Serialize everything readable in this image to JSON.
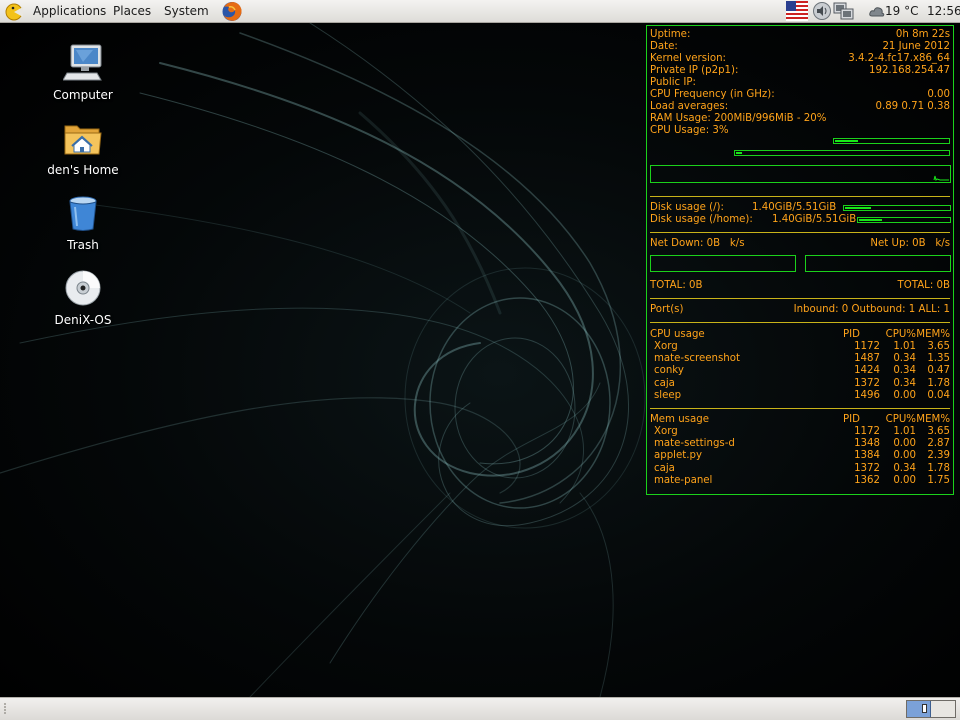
{
  "top_panel": {
    "menus": [
      "Applications",
      "Places",
      "System"
    ],
    "weather": "19 °C",
    "clock": "12:56"
  },
  "desktop_icons": [
    {
      "label": "Computer",
      "icon": "computer-icon"
    },
    {
      "label": "den's Home",
      "icon": "home-folder-icon"
    },
    {
      "label": "Trash",
      "icon": "trash-icon"
    },
    {
      "label": "DeniX-OS",
      "icon": "disc-icon"
    }
  ],
  "conky": {
    "uptime_label": "Uptime:",
    "uptime": "0h 8m 22s",
    "date_label": "Date:",
    "date": "21 June 2012",
    "kernel_label": "Kernel version:",
    "kernel": "3.4.2-4.fc17.x86_64",
    "private_ip_label": "Private IP (p2p1):",
    "private_ip": "192.168.254.47",
    "public_ip_label": "Public IP:",
    "cpu_freq_label": "CPU Frequency (in GHz):",
    "cpu_freq": "0.00",
    "load_label": "Load averages:",
    "load": "0.89 0.71 0.38",
    "ram_label": "RAM Usage:",
    "ram": "200MiB/996MiB - 20%",
    "ram_fraction": 0.2,
    "cpu_label": "CPU Usage:",
    "cpu": "3%",
    "cpu_fraction": 0.03,
    "disk_root_label": "Disk usage (/):",
    "disk_root": "1.40GiB/5.51GiB",
    "disk_root_fraction": 0.25,
    "disk_home_label": "Disk usage (/home):",
    "disk_home": "1.40GiB/5.51GiB",
    "disk_home_fraction": 0.25,
    "net_down_label": "Net Down:",
    "net_down": "0B",
    "net_down_unit": "k/s",
    "net_up_label": "Net Up:",
    "net_up": "0B",
    "net_up_unit": "k/s",
    "total_down_label": "TOTAL:",
    "total_down": "0B",
    "total_up_label": "TOTAL:",
    "total_up": "0B",
    "ports_label": "Port(s)",
    "inbound_label": "Inbound:",
    "inbound": "0",
    "outbound_label": "Outbound:",
    "outbound": "1",
    "all_label": "ALL:",
    "all": "1",
    "cpu_usage_title": "CPU usage",
    "mem_usage_title": "Mem usage",
    "col_pid": "PID",
    "col_cpu": "CPU%",
    "col_mem": "MEM%",
    "cpu_procs": [
      {
        "name": "Xorg",
        "pid": "1172",
        "cpu": "1.01",
        "mem": "3.65"
      },
      {
        "name": "mate-screenshot",
        "pid": "1487",
        "cpu": "0.34",
        "mem": "1.35"
      },
      {
        "name": "conky",
        "pid": "1424",
        "cpu": "0.34",
        "mem": "0.47"
      },
      {
        "name": "caja",
        "pid": "1372",
        "cpu": "0.34",
        "mem": "1.78"
      },
      {
        "name": "sleep",
        "pid": "1496",
        "cpu": "0.00",
        "mem": "0.04"
      }
    ],
    "mem_procs": [
      {
        "name": "Xorg",
        "pid": "1172",
        "cpu": "1.01",
        "mem": "3.65"
      },
      {
        "name": "mate-settings-d",
        "pid": "1348",
        "cpu": "0.00",
        "mem": "2.87"
      },
      {
        "name": "applet.py",
        "pid": "1384",
        "cpu": "0.00",
        "mem": "2.39"
      },
      {
        "name": "caja",
        "pid": "1372",
        "cpu": "0.34",
        "mem": "1.78"
      },
      {
        "name": "mate-panel",
        "pid": "1362",
        "cpu": "0.00",
        "mem": "1.75"
      }
    ]
  },
  "colors": {
    "conky_text": "#ffa31a",
    "conky_accent": "#1bd11b",
    "conky_divider": "#c8b319"
  }
}
